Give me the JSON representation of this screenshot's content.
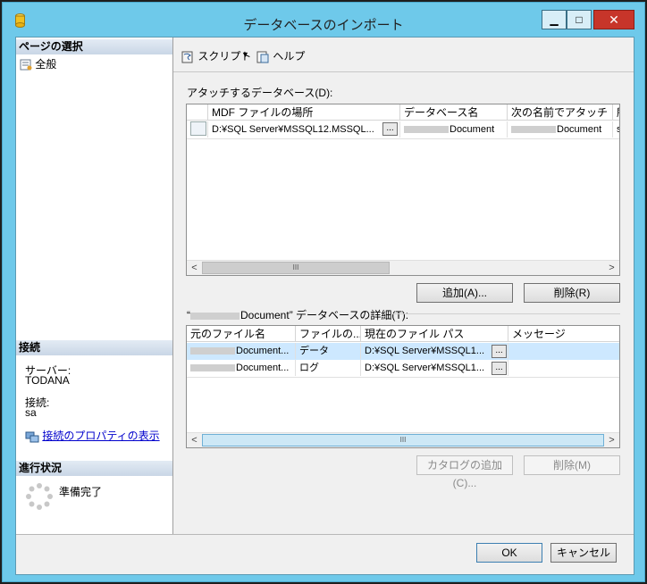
{
  "window": {
    "title": "データベースのインポート",
    "min_glyph": "▁",
    "max_glyph": "□",
    "close_glyph": "✕"
  },
  "left": {
    "select_page_header": "ページの選択",
    "page_general": "全般",
    "connection_header": "接続",
    "server_label": "サーバー:",
    "server_value": "TODANA",
    "connection_label": "接続:",
    "connection_value": "sa",
    "view_props_link": "接続のプロパティの表示",
    "progress_header": "進行状況",
    "progress_status": "準備完了"
  },
  "toolbar": {
    "script": "スクリプト",
    "dropdown": "▼",
    "help": "ヘルプ"
  },
  "attach": {
    "label": "アタッチするデータベース(D):",
    "columns": [
      "MDF ファイルの場所",
      "データベース名",
      "次の名前でアタッチ",
      "所"
    ],
    "row": {
      "mdf": "D:¥SQL Server¥MSSQL12.MSSQL...",
      "dbname": "Document",
      "attach_as": "Document",
      "owner": "s"
    },
    "add_button": "追加(A)...",
    "remove_button": "削除(R)"
  },
  "details": {
    "label_q_open": "“",
    "label_name": "Document",
    "label_rest": "” データベースの詳細(T):",
    "columns": [
      "元のファイル名",
      "ファイルの...",
      "現在のファイル パス",
      "メッセージ"
    ],
    "rows": [
      {
        "orig": "Document...",
        "type": "データ",
        "path": "D:¥SQL Server¥MSSQL1...",
        "msg": ""
      },
      {
        "orig": "Document...",
        "type": "ログ",
        "path": "D:¥SQL Server¥MSSQL1...",
        "msg": ""
      }
    ],
    "add_catalog_button": "カタログの追加(C)...",
    "remove_button": "削除(M)"
  },
  "footer": {
    "ok": "OK",
    "cancel": "キャンセル"
  },
  "scroll": {
    "left": "<",
    "right": ">",
    "thumb": "III",
    "ellipsis": "..."
  }
}
